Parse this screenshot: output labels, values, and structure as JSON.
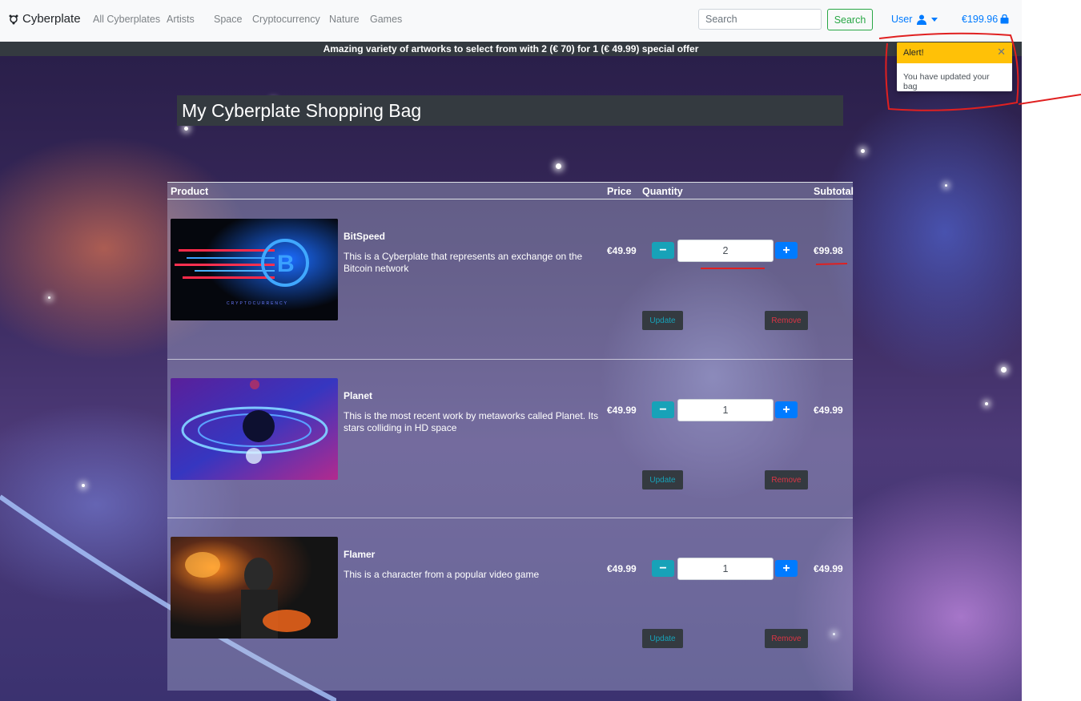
{
  "nav": {
    "brand": "Cyberplate",
    "links": [
      "All Cyberplates",
      "Artists",
      "Space",
      "Cryptocurrency",
      "Nature",
      "Games"
    ],
    "search_placeholder": "Search",
    "search_button": "Search",
    "user_label": "User",
    "bag_total": "€199.96"
  },
  "promo": "Amazing variety of artworks to select from with 2 (€ 70) for 1 (€ 49.99) special offer",
  "page_title": "My Cyberplate Shopping Bag",
  "table": {
    "headers": {
      "product": "Product",
      "price": "Price",
      "quantity": "Quantity",
      "subtotal": "Subtotal"
    },
    "rows": [
      {
        "name": "BitSpeed",
        "description": "This is a Cyberplate that represents an exchange on the Bitcoin network",
        "price": "€49.99",
        "quantity": "2",
        "subtotal": "€99.98",
        "update": "Update",
        "remove": "Remove",
        "image_icon": "bitcoin-art-icon"
      },
      {
        "name": "Planet",
        "description": "This is the most recent work by metaworks called Planet. Its stars colliding in HD space",
        "price": "€49.99",
        "quantity": "1",
        "subtotal": "€49.99",
        "update": "Update",
        "remove": "Remove",
        "image_icon": "planet-art-icon"
      },
      {
        "name": "Flamer",
        "description": "This is a character from a popular video game",
        "price": "€49.99",
        "quantity": "1",
        "subtotal": "€49.99",
        "update": "Update",
        "remove": "Remove",
        "image_icon": "flamer-art-icon"
      }
    ]
  },
  "bitspeed_art_text": "CRYPTOCURRENCY",
  "toast": {
    "title": "Alert!",
    "message": "You have updated your bag"
  },
  "colors": {
    "accent": "#007bff",
    "success": "#28a745",
    "info": "#17a2b8",
    "danger": "#dc3545",
    "warning": "#ffc107",
    "dark": "#343a40",
    "annotation": "#e02020"
  }
}
